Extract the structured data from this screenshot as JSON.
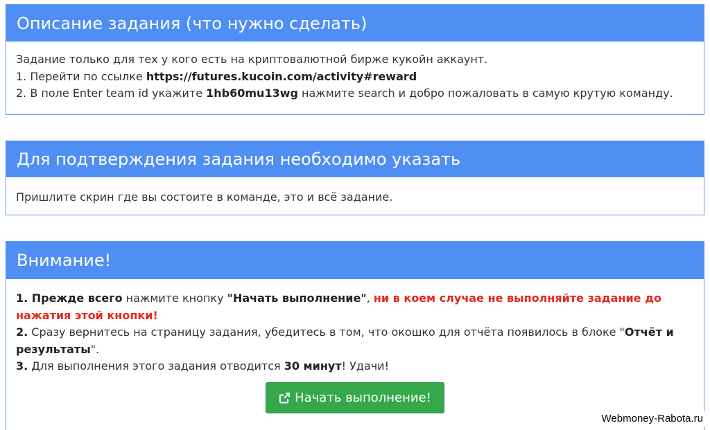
{
  "panel1": {
    "title": "Описание задания (что нужно сделать)",
    "line1": "Задание только для тех у кого есть на криптовалютной бирже кукойн аккаунт.",
    "line2_prefix": "1. Перейти по ссылке ",
    "line2_link": "https://futures.kucoin.com/activity#reward",
    "line3_prefix": "2. В поле Enter team id укажите ",
    "line3_code": "1hb60mu13wg",
    "line3_suffix": " нажмите search и добро пожаловать в самую крутую команду."
  },
  "panel2": {
    "title": "Для подтверждения задания необходимо указать",
    "text": "Пришлите скрин где вы состоите в команде, это и всё задание."
  },
  "panel3": {
    "title": "Внимание!",
    "item1_num": "1. Прежде всего",
    "item1_mid": " нажмите кнопку ",
    "item1_btn": "\"Начать выполнение\"",
    "item1_comma": ", ",
    "item1_warn": "ни в коем случае не выполняйте задание до нажатия этой кнопки!",
    "item2_num": "2.",
    "item2_text": " Сразу вернитесь на страницу задания, убедитесь в том, что окошко для отчёта появилось в блоке \"",
    "item2_bold": "Отчёт и результаты",
    "item2_end": "\".",
    "item3_num": "3.",
    "item3_text": " Для выполнения этого задания отводится ",
    "item3_bold": "30 минут",
    "item3_end": "! Удачи!",
    "button_label": "Начать выполнение!",
    "button_icon": "external-link-icon"
  },
  "watermark": "Webmoney-Rabota.ru",
  "colors": {
    "header_blue": "#4f8ff3",
    "warning_red": "#e5271d",
    "button_green": "#35a84b"
  }
}
